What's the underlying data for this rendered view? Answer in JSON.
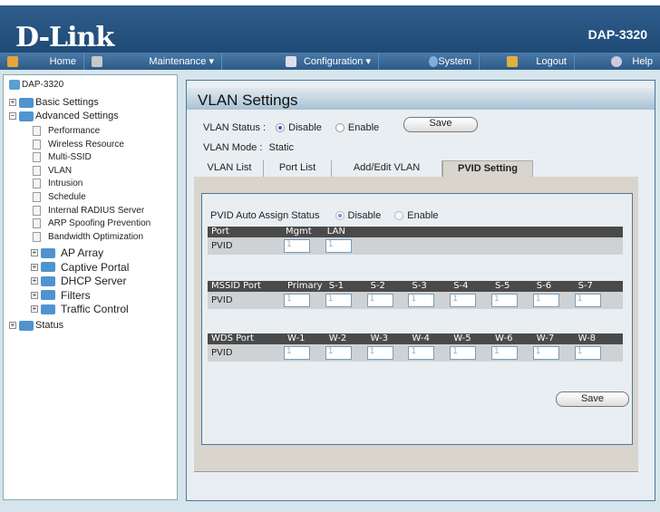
{
  "header": {
    "logo": "D-Link",
    "model": "DAP-3320"
  },
  "nav": [
    {
      "label": "Home",
      "icon": "home-icon"
    },
    {
      "label": "Maintenance",
      "icon": "tools-icon",
      "dropdown": true
    },
    {
      "label": "Configuration",
      "icon": "disk-icon",
      "dropdown": true
    },
    {
      "label": "System",
      "icon": "system-icon"
    },
    {
      "label": "Logout",
      "icon": "logout-icon"
    },
    {
      "label": "Help",
      "icon": "help-icon"
    }
  ],
  "sidebar": {
    "root": "DAP-3320",
    "basic": "Basic Settings",
    "advanced": "Advanced Settings",
    "adv_items": [
      "Performance",
      "Wireless Resource",
      "Multi-SSID",
      "VLAN",
      "Intrusion",
      "Schedule",
      "Internal RADIUS Server",
      "ARP Spoofing Prevention",
      "Bandwidth Optimization"
    ],
    "adv_folders": [
      "AP Array",
      "Captive Portal",
      "DHCP Server",
      "Filters",
      "Traffic Control"
    ],
    "status": "Status"
  },
  "main": {
    "title": "VLAN Settings",
    "vlan_status_label": "VLAN Status :",
    "disable": "Disable",
    "enable": "Enable",
    "save": "Save",
    "vlan_status_value": "Disable",
    "vlan_mode_label": "VLAN Mode :",
    "vlan_mode_value": "Static",
    "tabs": [
      "VLAN List",
      "Port List",
      "Add/Edit VLAN",
      "PVID Setting"
    ],
    "active_tab": "PVID Setting",
    "pvid_auto_label": "PVID Auto Assign Status",
    "pvid_auto_value": "Disable",
    "table1": {
      "headers": [
        "Port",
        "Mgmt",
        "LAN"
      ],
      "row_label": "PVID",
      "values": [
        "1",
        "1"
      ]
    },
    "table2": {
      "headers": [
        "MSSID Port",
        "Primary",
        "S-1",
        "S-2",
        "S-3",
        "S-4",
        "S-5",
        "S-6",
        "S-7"
      ],
      "row_label": "PVID",
      "values": [
        "1",
        "1",
        "1",
        "1",
        "1",
        "1",
        "1",
        "1"
      ]
    },
    "table3": {
      "headers": [
        "WDS Port",
        "W-1",
        "W-2",
        "W-3",
        "W-4",
        "W-5",
        "W-6",
        "W-7",
        "W-8"
      ],
      "row_label": "PVID",
      "values": [
        "1",
        "1",
        "1",
        "1",
        "1",
        "1",
        "1",
        "1"
      ]
    },
    "save_bottom": "Save"
  }
}
